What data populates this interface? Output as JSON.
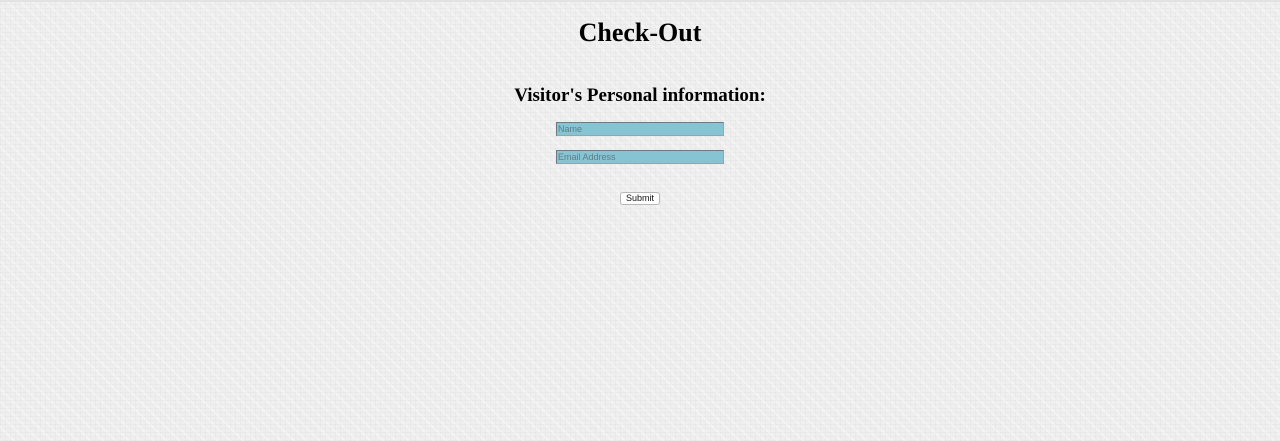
{
  "page": {
    "title": "Check-Out"
  },
  "form": {
    "heading": "Visitor's Personal information:",
    "name_placeholder": "Name",
    "name_value": "",
    "email_placeholder": "Email Address",
    "email_value": "",
    "submit_label": "Submit"
  },
  "colors": {
    "input_background": "#86c3d3",
    "page_background": "#efefef"
  }
}
